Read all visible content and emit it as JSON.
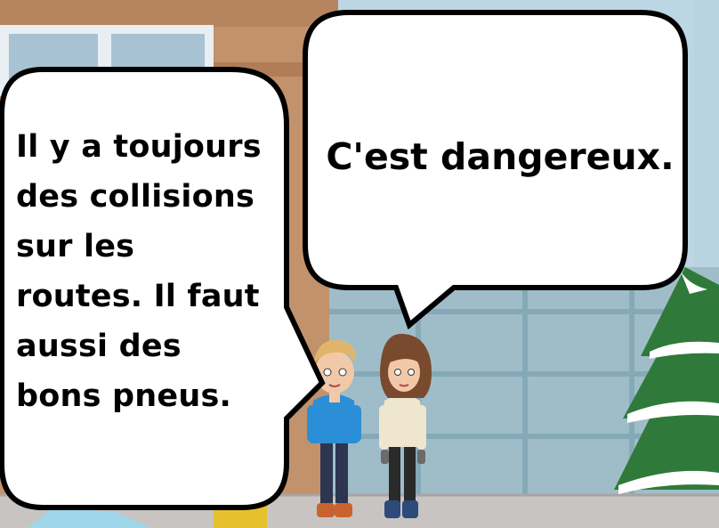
{
  "speech_bubbles": {
    "left": "Il y a toujours\ndes collisions\nsur les\nroutes. Il faut\naussi des\nbons pneus.",
    "right": "C'est dangereux."
  },
  "colors": {
    "sky": "#bcd6e4",
    "building_brown": "#c2926c",
    "glass_wall": "#9fbdc9",
    "sidewalk": "#c8c4c2",
    "tree_green": "#2f7a3a",
    "snow": "#ffffff",
    "boy_jacket": "#2a8fd6",
    "girl_jacket": "#efe6cf"
  }
}
